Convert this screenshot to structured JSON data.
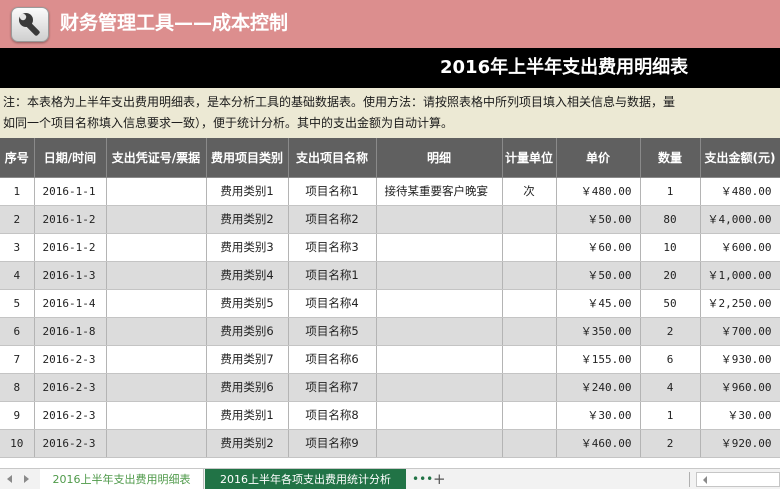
{
  "app": {
    "title": "财务管理工具——成本控制",
    "icon": "wrench-icon"
  },
  "sheet": {
    "title": "2016年上半年支出费用明细表",
    "notes": [
      "注：本表格为上半年支出费用明细表，是本分析工具的基础数据表。使用方法：请按照表格中所列项目填入相关信息与数据，量",
      "如同一个项目名称填入信息要求一致），便于统计分析。其中的支出金额为自动计算。"
    ]
  },
  "table": {
    "headers": [
      "序号",
      "日期/时间",
      "支出凭证号/票据",
      "费用项目类别",
      "支出项目名称",
      "明细",
      "计量单位",
      "单价",
      "数量",
      "支出金额(元)"
    ],
    "rows": [
      [
        "1",
        "2016-1-1",
        "",
        "费用类别1",
        "项目名称1",
        "接待某重要客户晚宴",
        "次",
        "￥480.00",
        "1",
        "￥480.00"
      ],
      [
        "2",
        "2016-1-2",
        "",
        "费用类别2",
        "项目名称2",
        "",
        "",
        "￥50.00",
        "80",
        "￥4,000.00"
      ],
      [
        "3",
        "2016-1-2",
        "",
        "费用类别3",
        "项目名称3",
        "",
        "",
        "￥60.00",
        "10",
        "￥600.00"
      ],
      [
        "4",
        "2016-1-3",
        "",
        "费用类别4",
        "项目名称1",
        "",
        "",
        "￥50.00",
        "20",
        "￥1,000.00"
      ],
      [
        "5",
        "2016-1-4",
        "",
        "费用类别5",
        "项目名称4",
        "",
        "",
        "￥45.00",
        "50",
        "￥2,250.00"
      ],
      [
        "6",
        "2016-1-8",
        "",
        "费用类别6",
        "项目名称5",
        "",
        "",
        "￥350.00",
        "2",
        "￥700.00"
      ],
      [
        "7",
        "2016-2-3",
        "",
        "费用类别7",
        "项目名称6",
        "",
        "",
        "￥155.00",
        "6",
        "￥930.00"
      ],
      [
        "8",
        "2016-2-3",
        "",
        "费用类别6",
        "项目名称7",
        "",
        "",
        "￥240.00",
        "4",
        "￥960.00"
      ],
      [
        "9",
        "2016-2-3",
        "",
        "费用类别1",
        "项目名称8",
        "",
        "",
        "￥30.00",
        "1",
        "￥30.00"
      ],
      [
        "10",
        "2016-2-3",
        "",
        "费用类别2",
        "项目名称9",
        "",
        "",
        "￥460.00",
        "2",
        "￥920.00"
      ]
    ]
  },
  "tabs": [
    {
      "label": "2016上半年支出费用明细表",
      "active": true
    },
    {
      "label": "2016上半年各项支出费用统计分析",
      "active": false
    }
  ],
  "tabbar": {
    "more": "•••",
    "add": "+"
  },
  "colors": {
    "banner": "#dc8e8e",
    "header": "#606060",
    "title_bar": "#000000",
    "active_tab_text": "#4f9a4a",
    "other_tab": "#217346"
  }
}
